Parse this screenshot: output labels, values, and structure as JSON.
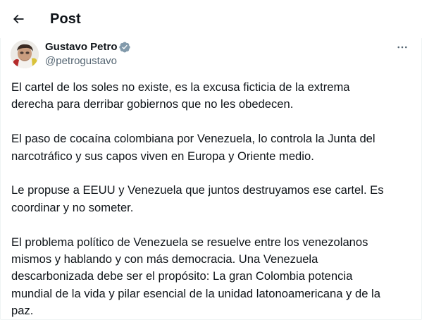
{
  "header": {
    "title": "Post",
    "back_icon": "back-arrow-icon"
  },
  "author": {
    "name": "Gustavo Petro",
    "handle": "@petrogustavo",
    "verified": true,
    "verified_color": "#1d9bf0"
  },
  "actions": {
    "more_icon": "more-options-icon"
  },
  "post": {
    "paragraphs": [
      {
        "lines": [
          "El cartel de los soles no existe, es la excusa ficticia de la extrema",
          "derecha para derribar gobiernos que no les obedecen."
        ]
      },
      {
        "lines": [
          "El paso de cocaína colombiana por Venezuela, lo controla la Junta del",
          "narcotráfico y sus capos viven en Europa y Oriente medio."
        ]
      },
      {
        "lines": [
          "Le propuse a EEUU y Venezuela que juntos destruyamos ese cartel. Es",
          "coordinar y no someter."
        ]
      },
      {
        "lines": [
          "El problema político de Venezuela se resuelve entre los venezolanos",
          "mismos y hablando y con más democracia. Una Venezuela",
          "descarbonizada debe ser el propósito: La gran Colombia potencia",
          "mundial de la vida y pilar esencial de la unidad latonoamericana y de la",
          "paz."
        ]
      }
    ]
  }
}
